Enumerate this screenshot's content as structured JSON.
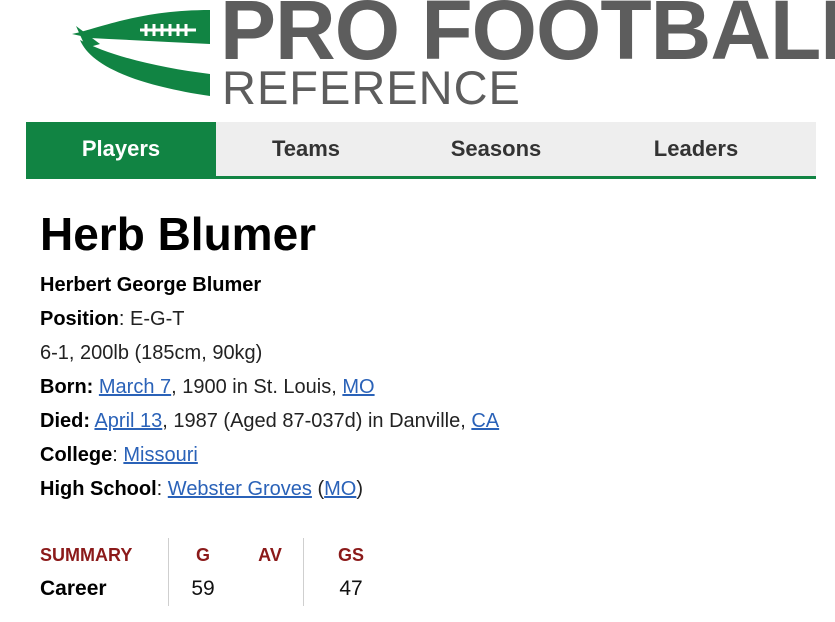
{
  "logo": {
    "top": "PRO FOOTBALL",
    "bottom": "REFERENCE"
  },
  "nav": {
    "items": [
      "Players",
      "Teams",
      "Seasons",
      "Leaders"
    ],
    "active": "Players"
  },
  "player": {
    "name": "Herb Blumer",
    "full_name": "Herbert George Blumer",
    "position_label": "Position",
    "position": "E-G-T",
    "measurements": "6-1, 200lb (185cm, 90kg)",
    "born_label": "Born:",
    "born_date": "March 7",
    "born_rest": ", 1900 in St. Louis, ",
    "born_state": "MO",
    "died_label": "Died:",
    "died_date": "April 13",
    "died_rest": ", 1987 (Aged 87-037d) in Danville, ",
    "died_state": "CA",
    "college_label": "College",
    "college": "Missouri",
    "high_school_label": "High School",
    "high_school": "Webster Groves",
    "high_school_state": "MO"
  },
  "summary": {
    "headers": [
      "SUMMARY",
      "G",
      "AV",
      "GS"
    ],
    "row": {
      "label": "Career",
      "g": "59",
      "av": "",
      "gs": "47"
    }
  },
  "colors": {
    "brand_green": "#118443",
    "logo_gray": "#5d5d5d",
    "summary_red": "#8b1a1a",
    "link": "#2a62b8"
  }
}
